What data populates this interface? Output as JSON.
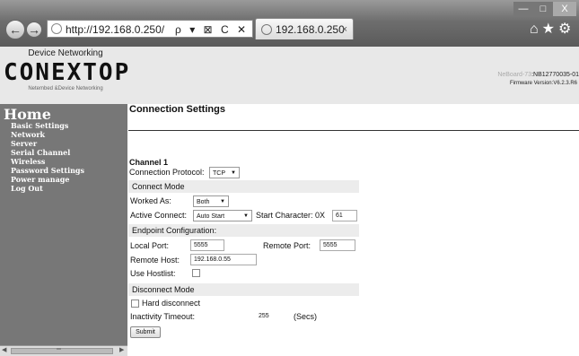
{
  "browser": {
    "url": "http://192.168.0.250/",
    "address_tools": "ρ ▾ ⊠ C ✕",
    "tab_title": "192.168.0.250",
    "tab_close": "×",
    "back_glyph": "←",
    "forward_glyph": "→",
    "min_glyph": "—",
    "max_glyph": "□",
    "close_glyph": "X",
    "right_icons": "⌂★⚙"
  },
  "header": {
    "subtitle": "Device Networking",
    "logo": "CONEXTOP",
    "tagline": "Netembed &Device Networking",
    "board_prefix": "NeBoard-73",
    "board_id": ":NB12770035-01",
    "firmware": "Firmware Version:V6.2.3.R6"
  },
  "sidebar": {
    "home": "Home",
    "items": [
      "Basic Settings",
      "Network",
      "Server",
      "Serial Channel",
      "Wireless",
      "Password Settings",
      "Power manage",
      "Log Out"
    ],
    "scroll_left": "◀",
    "scroll_right": "▶",
    "scroll_grip": "═"
  },
  "main": {
    "title": "Connection Settings",
    "channel_title": "Channel 1",
    "protocol_label": "Connection Protocol:",
    "protocol_value": "TCP",
    "connect_mode_header": "Connect Mode",
    "worked_as_label": "Worked As:",
    "worked_as_value": "Both",
    "active_connect_label": "Active Connect:",
    "active_connect_value": "Auto Start",
    "start_char_label": "Start Character: 0X",
    "start_char_value": "61",
    "endpoint_header": "Endpoint Configuration:",
    "local_port_label": "Local Port:",
    "local_port_value": "5555",
    "remote_port_label": "Remote Port:",
    "remote_port_value": "5555",
    "remote_host_label": "Remote Host:",
    "remote_host_value": "192.168.0.55",
    "use_hostlist_label": "Use Hostlist:",
    "disconnect_header": "Disconnect Mode",
    "hard_disconnect_label": "Hard disconnect",
    "inactivity_label": "Inactivity Timeout:",
    "inactivity_value": "255",
    "inactivity_unit": "(Secs)",
    "submit_label": "Submit"
  }
}
